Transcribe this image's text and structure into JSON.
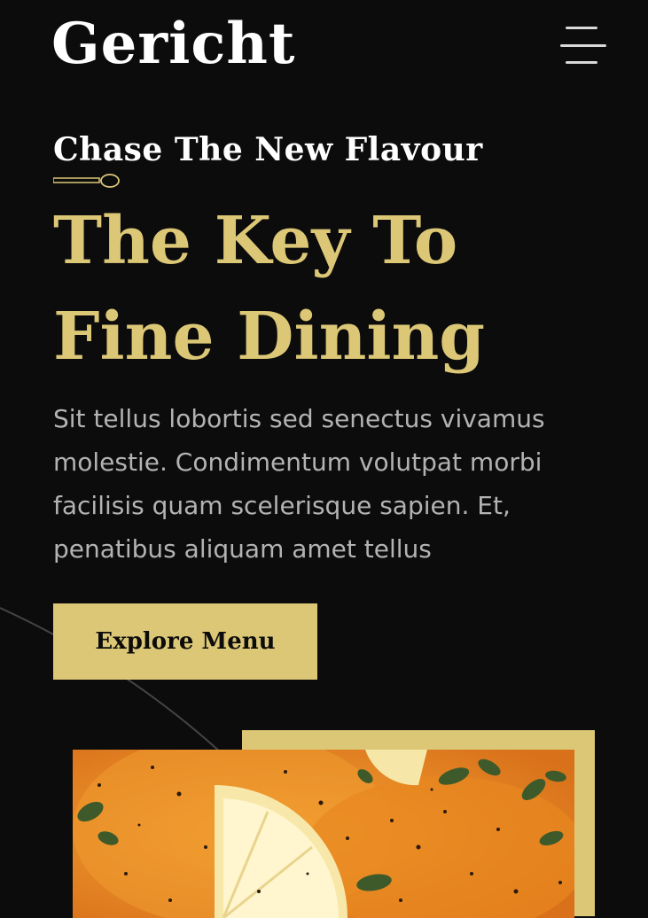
{
  "header": {
    "logo": "Gericht",
    "menu_icon": "hamburger-menu-icon"
  },
  "hero": {
    "subtitle": "Chase The New Flavour",
    "divider_icon": "spoon-icon",
    "title": "The Key To Fine Dining",
    "description": "Sit tellus lobortis sed senectus vivamus molestie. Condimentum volutpat morbi facilisis quam scelerisque sapien. Et, penatibus aliquam amet tellus",
    "cta_label": "Explore Menu"
  },
  "colors": {
    "background": "#0c0c0c",
    "accent_gold": "#dcc776",
    "text_white": "#ffffff",
    "text_grey": "#b3b3b3"
  },
  "image": {
    "subject": "food-dish-photo"
  }
}
